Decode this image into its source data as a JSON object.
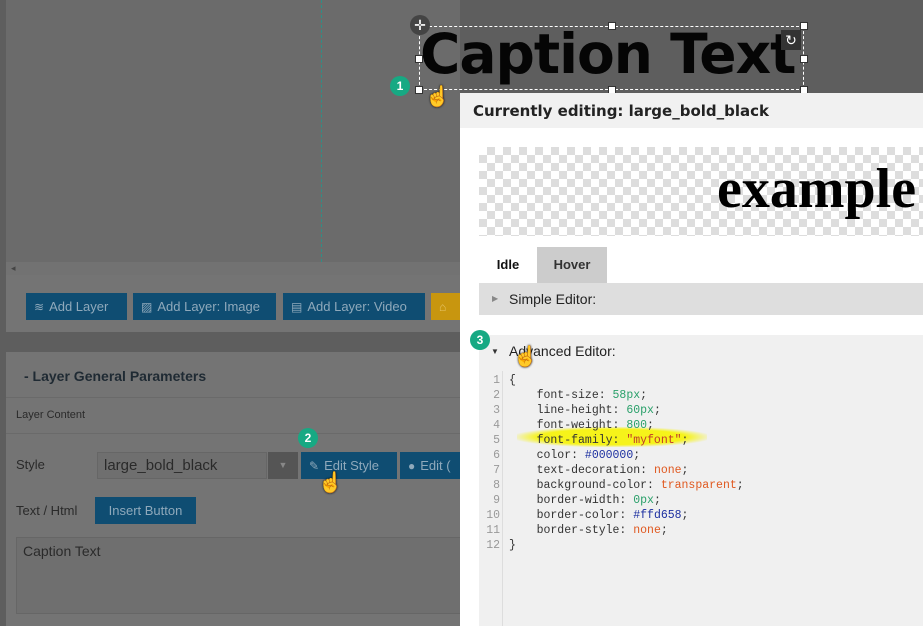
{
  "canvas": {
    "caption_text": "Caption Text",
    "scroll_left": "◂"
  },
  "toolbar": {
    "buttons": [
      {
        "label": "Add Layer",
        "icon": "≋"
      },
      {
        "label": "Add Layer: Image",
        "icon": "▨"
      },
      {
        "label": "Add Layer: Video",
        "icon": "▤"
      },
      {
        "label": "",
        "icon": "⌂"
      }
    ]
  },
  "panel": {
    "title": "-  Layer General Parameters",
    "section": "Layer Content",
    "style_label": "Style",
    "style_value": "large_bold_black",
    "edit_style": "Edit Style",
    "edit_2": "Edit (",
    "text_label": "Text / Html",
    "insert_button": "Insert Button",
    "textarea_value": "Caption Text"
  },
  "badges": [
    "1",
    "2",
    "3"
  ],
  "modal": {
    "title": "Currently editing: large_bold_black",
    "preview_text": "example",
    "tabs": [
      "Idle",
      "Hover"
    ],
    "simple_editor": "Simple Editor:",
    "advanced_editor": "Advanced Editor:",
    "code": [
      {
        "n": "1",
        "parts": [
          [
            "k",
            "{"
          ]
        ]
      },
      {
        "n": "2",
        "parts": [
          [
            "k",
            "    font-size: "
          ],
          [
            "g",
            "58px"
          ],
          [
            "k",
            ";"
          ]
        ]
      },
      {
        "n": "3",
        "parts": [
          [
            "k",
            "    line-height: "
          ],
          [
            "g",
            "60px"
          ],
          [
            "k",
            ";"
          ]
        ]
      },
      {
        "n": "4",
        "parts": [
          [
            "k",
            "    font-weight: "
          ],
          [
            "g",
            "800"
          ],
          [
            "k",
            ";"
          ]
        ]
      },
      {
        "n": "5",
        "parts": [
          [
            "k",
            "    font-family: "
          ],
          [
            "r",
            "\"myfont\""
          ],
          [
            "k",
            ";"
          ]
        ]
      },
      {
        "n": "6",
        "parts": [
          [
            "k",
            "    color: "
          ],
          [
            "b",
            "#000000"
          ],
          [
            "k",
            ";"
          ]
        ]
      },
      {
        "n": "7",
        "parts": [
          [
            "k",
            "    text-decoration: "
          ],
          [
            "o",
            "none"
          ],
          [
            "k",
            ";"
          ]
        ]
      },
      {
        "n": "8",
        "parts": [
          [
            "k",
            "    background-color: "
          ],
          [
            "o",
            "transparent"
          ],
          [
            "k",
            ";"
          ]
        ]
      },
      {
        "n": "9",
        "parts": [
          [
            "k",
            "    border-width: "
          ],
          [
            "g",
            "0px"
          ],
          [
            "k",
            ";"
          ]
        ]
      },
      {
        "n": "10",
        "parts": [
          [
            "k",
            "    border-color: "
          ],
          [
            "b",
            "#ffd658"
          ],
          [
            "k",
            ";"
          ]
        ]
      },
      {
        "n": "11",
        "parts": [
          [
            "k",
            "    border-style: "
          ],
          [
            "o",
            "none"
          ],
          [
            "k",
            ";"
          ]
        ]
      },
      {
        "n": "12",
        "parts": [
          [
            "k",
            "}"
          ]
        ]
      }
    ]
  },
  "colors": {
    "button_blue": "#0f4d72",
    "accent_yellow": "#c8960f",
    "badge_green": "#17a983",
    "highlight": "#f6f31a"
  }
}
